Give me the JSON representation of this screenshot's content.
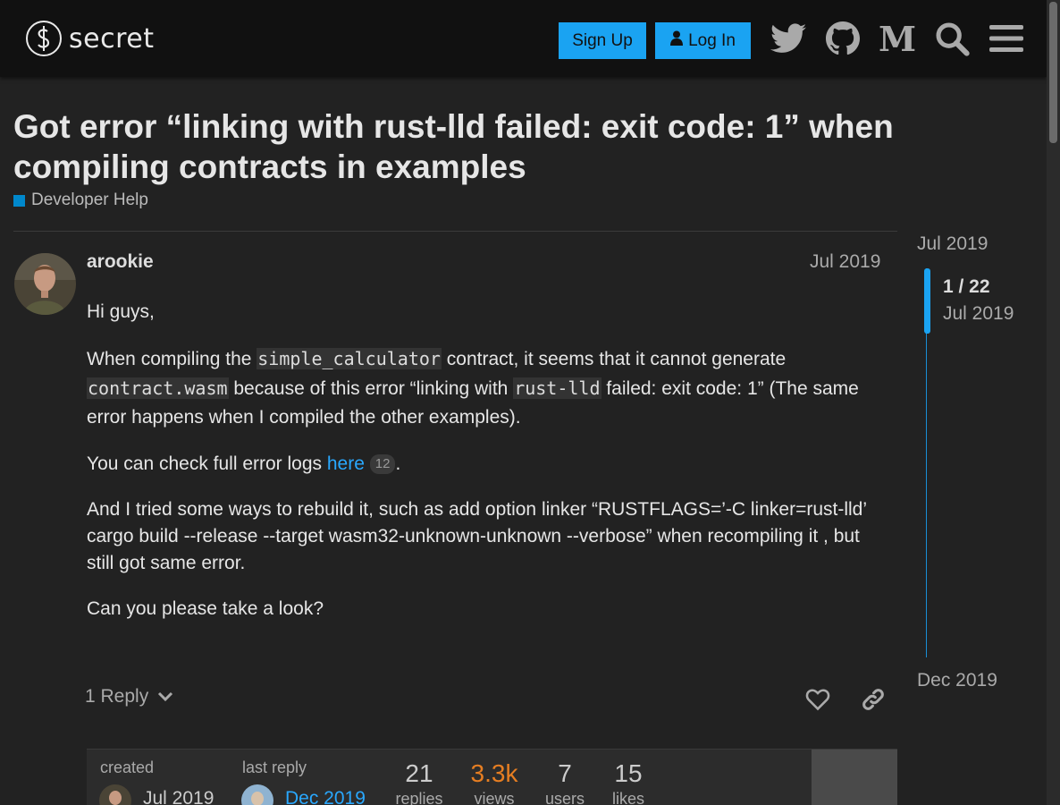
{
  "header": {
    "logo_text": "secret",
    "signup_label": "Sign Up",
    "login_label": "Log In",
    "medium_glyph": "M",
    "icons": [
      "twitter-icon",
      "github-icon",
      "medium-icon",
      "search-icon",
      "hamburger-menu-icon"
    ]
  },
  "topic": {
    "title": "Got error “linking with rust-lld failed: exit code: 1” when compiling contracts in examples",
    "category": "Developer Help",
    "category_color": "#0088cc"
  },
  "post": {
    "username": "arookie",
    "date": "Jul 2019",
    "greeting": "Hi guys,",
    "p2_a": "When compiling the ",
    "p2_code1": "simple_calculator",
    "p2_b": " contract, it seems that it cannot generate ",
    "p2_code2": "contract.wasm",
    "p2_c": " because of this error “linking with ",
    "p2_code3": "rust-lld",
    "p2_d": " failed: exit code: 1” (The same error happens when I compiled the other examples).",
    "p3_a": "You can check full error logs ",
    "p3_link": "here",
    "p3_clicks": "12",
    "p3_b": ".",
    "p4": "And I tried some ways to rebuild it, such as add option linker “RUSTFLAGS=’-C linker=rust-lld’ cargo build --release --target wasm32-unknown-unknown --verbose” when recompiling it , but still got same error.",
    "p5": "Can you please take a look?",
    "reply_label": "1 Reply"
  },
  "topic_map": {
    "created_label": "created",
    "created_date": "Jul 2019",
    "last_reply_label": "last reply",
    "last_reply_date": "Dec 2019",
    "stats": [
      {
        "num": "21",
        "label": "replies"
      },
      {
        "num": "3.3k",
        "label": "views"
      },
      {
        "num": "7",
        "label": "users"
      },
      {
        "num": "15",
        "label": "likes"
      }
    ]
  },
  "timeline": {
    "start_date": "Jul 2019",
    "position": "1 / 22",
    "position_date": "Jul 2019",
    "end_date": "Dec 2019"
  },
  "colors": {
    "accent": "#1aa3f2",
    "link": "#29a8ff",
    "views": "#e67e22",
    "background": "#222222",
    "header": "#111111"
  }
}
